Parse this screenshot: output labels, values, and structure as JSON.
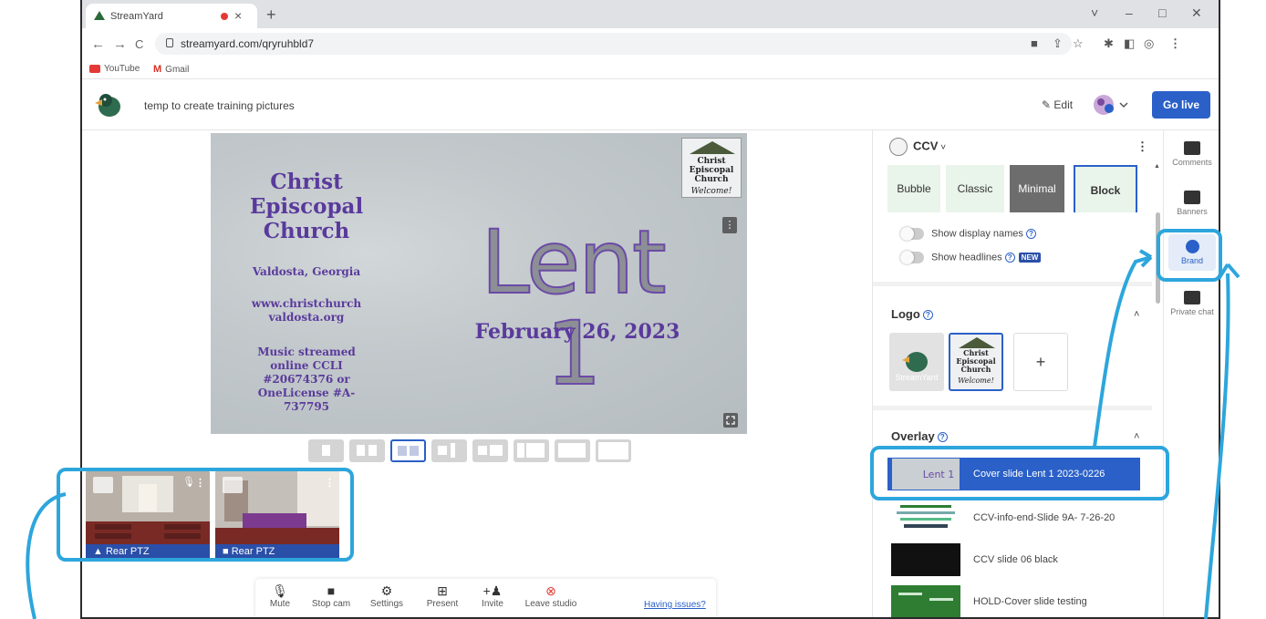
{
  "browser": {
    "tab_title": "StreamYard",
    "tab_close": "×",
    "new_tab": "+",
    "url": "streamyard.com/qryruhbld7",
    "nav_back": "←",
    "nav_forward": "→",
    "nav_reload": "C",
    "window": {
      "chevron": "˅",
      "minimize": "–",
      "restore": "□",
      "close": "✕"
    },
    "bookmarks": [
      {
        "label": "YouTube"
      },
      {
        "label": "Gmail"
      }
    ]
  },
  "app": {
    "title": "temp to create training pictures",
    "edit_label": "Edit",
    "go_live_label": "Go live"
  },
  "slide": {
    "title": "Christ Episcopal Church",
    "location": "Valdosta, Georgia",
    "website": "www.christchurch valdosta.org",
    "music": "Music streamed online CCLI #20674376 or OneLicense #A-737795",
    "headline": "Lent 1",
    "date": "February 26, 2023",
    "logo_text": "Christ Episcopal Church",
    "logo_welcome": "Welcome!"
  },
  "cameras": [
    {
      "label": "Rear PTZ"
    },
    {
      "label": "Rear PTZ"
    }
  ],
  "toolbar": {
    "items": [
      {
        "label": "Mute"
      },
      {
        "label": "Stop cam"
      },
      {
        "label": "Settings"
      },
      {
        "label": "Present"
      },
      {
        "label": "Invite"
      },
      {
        "label": "Leave studio"
      }
    ],
    "issues_link": "Having issues?"
  },
  "panel": {
    "brand_name": "CCV",
    "styles": [
      "Bubble",
      "Classic",
      "Minimal",
      "Block"
    ],
    "selected_style": "Block",
    "toggles": [
      {
        "label": "Show display names",
        "on": false
      },
      {
        "label": "Show headlines",
        "on": false,
        "badge": "NEW"
      }
    ],
    "logo_section": "Logo",
    "logo_tiles": {
      "streamyard_mark": "StreamYard",
      "add_label": "+"
    },
    "overlay_section": "Overlay",
    "overlays": [
      {
        "label": "Cover slide Lent 1 2023-0226",
        "selected": true
      },
      {
        "label": "CCV-info-end-Slide 9A- 7-26-20",
        "selected": false
      },
      {
        "label": "CCV slide 06 black",
        "selected": false
      },
      {
        "label": "HOLD-Cover slide testing",
        "selected": false
      }
    ],
    "overlay_thumb_text": "Lent 1"
  },
  "rail": [
    {
      "label": "Comments"
    },
    {
      "label": "Banners"
    },
    {
      "label": "Brand",
      "active": true
    },
    {
      "label": "Private chat"
    }
  ],
  "colors": {
    "accent": "#2a60c8",
    "callout": "#2da6dc",
    "slide_text": "#5a3a9c",
    "leave_icon": "#e53935"
  }
}
